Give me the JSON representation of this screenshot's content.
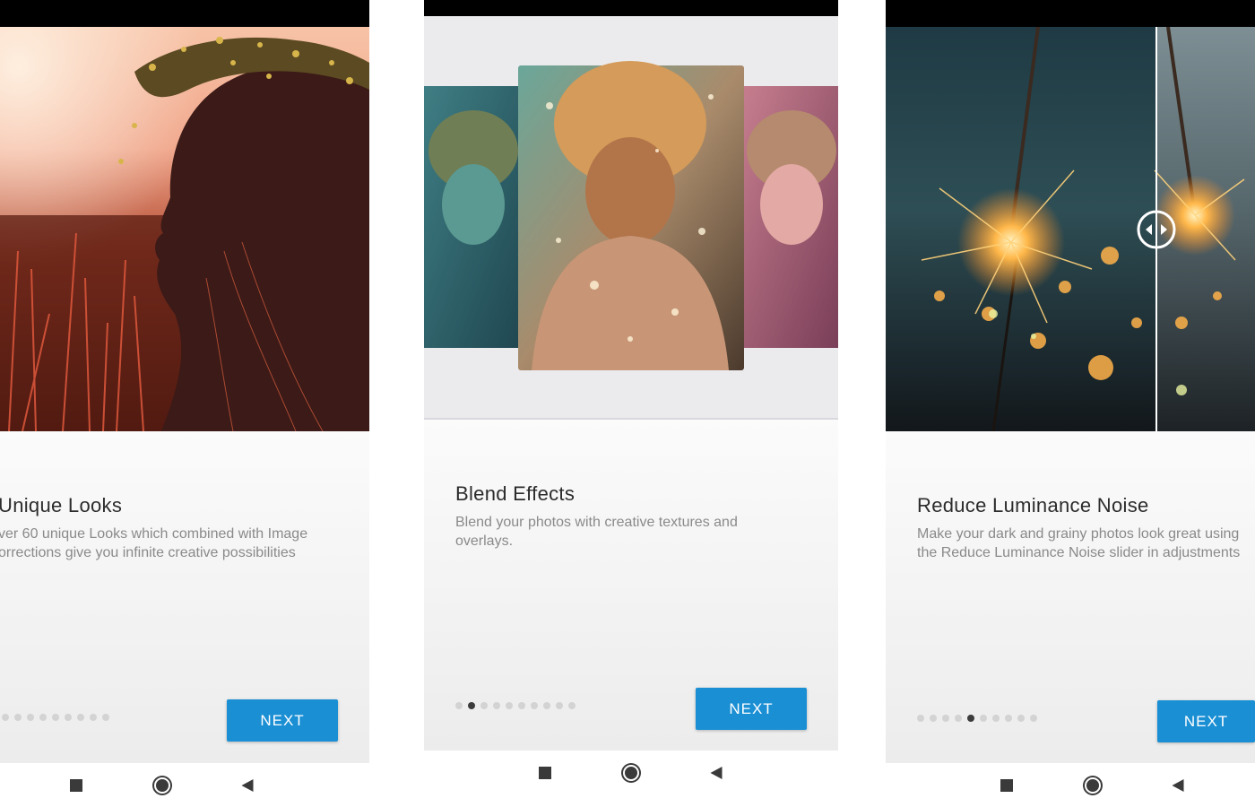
{
  "screens": [
    {
      "title": "Unique Looks",
      "description": "ver 60 unique Looks which combined with Image orrections give you infinite creative possibilities",
      "next_label": "NEXT",
      "dots_total": 9,
      "dots_active": 0
    },
    {
      "title": "Blend Effects",
      "description": "Blend your photos with creative textures and overlays.",
      "next_label": "NEXT",
      "dots_total": 10,
      "dots_active": 1
    },
    {
      "title": "Reduce Luminance Noise",
      "description": "Make your dark and grainy photos look great using the Reduce Luminance Noise slider in adjustments",
      "next_label": "NEXT",
      "dots_total": 10,
      "dots_active": 4
    }
  ],
  "nav": {
    "recents_icon": "square-recents-icon",
    "home_icon": "circle-home-icon",
    "back_icon": "triangle-back-icon"
  },
  "colors": {
    "accent": "#1a8fd4",
    "status_bar": "#000000",
    "card_top": "#fbfbfb",
    "card_bottom": "#ececec"
  }
}
